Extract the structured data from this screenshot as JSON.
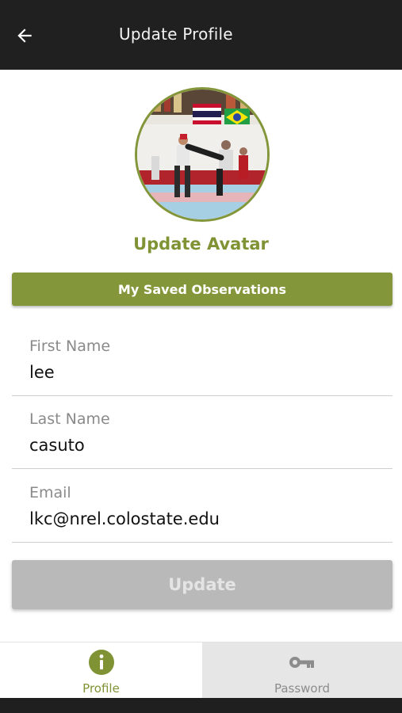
{
  "header": {
    "title": "Update Profile",
    "back_icon": "arrow-left-icon"
  },
  "profile": {
    "avatar_icon": "profile-photo",
    "update_avatar_label": "Update Avatar",
    "saved_observations_label": "My Saved Observations"
  },
  "form": {
    "first_name": {
      "label": "First Name",
      "value": "lee"
    },
    "last_name": {
      "label": "Last Name",
      "value": "casuto"
    },
    "email": {
      "label": "Email",
      "value": "lkc@nrel.colostate.edu"
    },
    "update_label": "Update"
  },
  "tabs": [
    {
      "label": "Profile",
      "icon": "info-circle-icon",
      "active": true
    },
    {
      "label": "Password",
      "icon": "key-icon",
      "active": false
    }
  ],
  "colors": {
    "accent": "#83963a",
    "header_bg": "#202020",
    "disabled_button": "#b9b9b9"
  }
}
